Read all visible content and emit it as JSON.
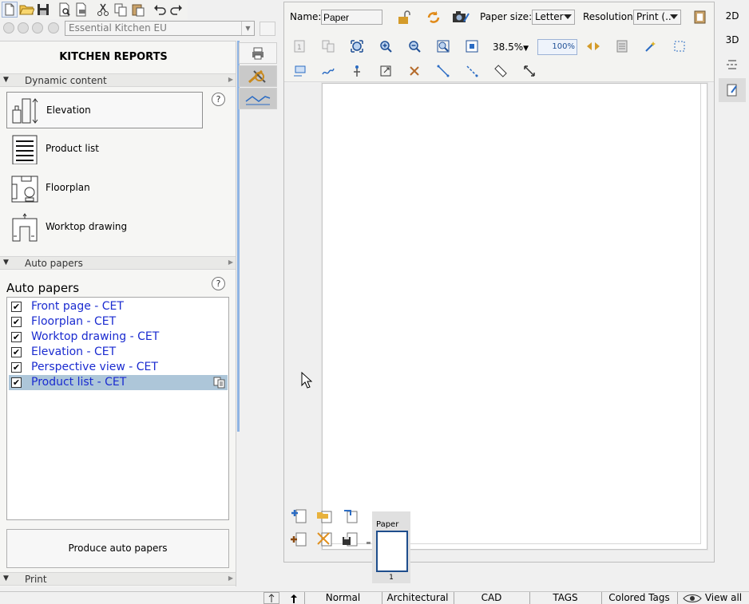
{
  "catalog": {
    "selected": "Essential Kitchen EU"
  },
  "left_panel": {
    "title": "KITCHEN REPORTS",
    "dynamic_section": {
      "label": "Dynamic content",
      "items": [
        {
          "label": "Elevation",
          "icon": "elevation-icon",
          "selected": true
        },
        {
          "label": "Product list",
          "icon": "product-list-icon"
        },
        {
          "label": "Floorplan",
          "icon": "floorplan-icon"
        },
        {
          "label": "Worktop drawing",
          "icon": "worktop-drawing-icon"
        }
      ]
    },
    "auto_section": {
      "label": "Auto papers"
    },
    "auto_papers_heading": "Auto papers",
    "papers": [
      {
        "label": "Front page - CET",
        "checked": true
      },
      {
        "label": "Floorplan - CET",
        "checked": true
      },
      {
        "label": "Worktop drawing - CET",
        "checked": true
      },
      {
        "label": "Elevation - CET",
        "checked": true
      },
      {
        "label": "Perspective view - CET",
        "checked": true
      },
      {
        "label": "Product list - CET",
        "checked": true,
        "selected": true
      }
    ],
    "produce_button": "Produce auto papers",
    "print_section": {
      "label": "Print"
    },
    "help_glyph": "?"
  },
  "paper_toolbar": {
    "name_label": "Name:",
    "name_value": "Paper",
    "paper_size_label": "Paper size:",
    "paper_size_value": "Letter",
    "resolution_label": "Resolution:",
    "resolution_value": "Print (..",
    "zoom_value": "38.5%",
    "zoom_100": "100%"
  },
  "page_strip": {
    "tab_label": "Paper",
    "page_number": "1"
  },
  "right_rail": {
    "btn_2d": "2D",
    "btn_3d": "3D"
  },
  "status_bar": {
    "modes": [
      "Normal",
      "Architectural",
      "CAD",
      "TAGS",
      "Colored Tags"
    ],
    "view_all": "View all"
  },
  "colors": {
    "link_blue": "#1a2bd0",
    "selection": "#adc6d9",
    "accent_strip": "#8fb4e3"
  }
}
